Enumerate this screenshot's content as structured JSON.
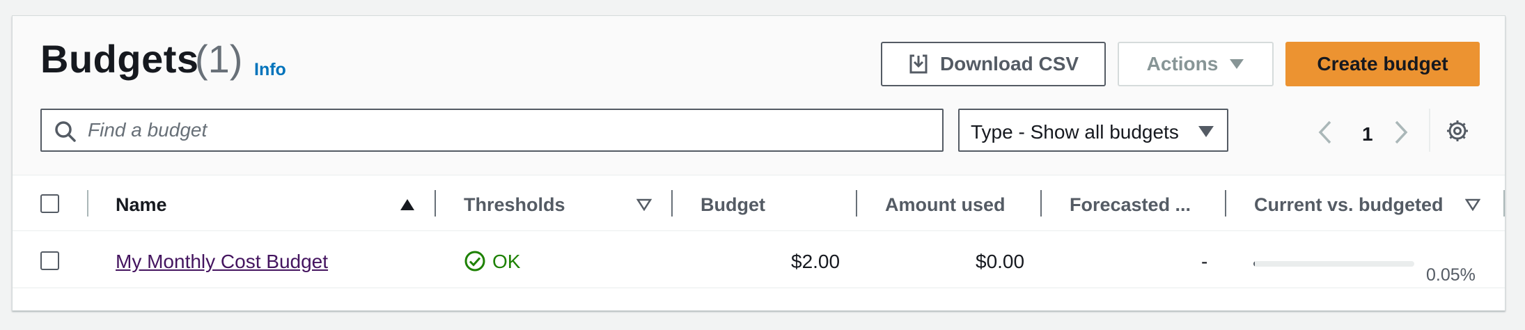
{
  "header": {
    "title": "Budgets",
    "count": "(1)",
    "info_label": "Info",
    "download_label": "Download CSV",
    "actions_label": "Actions",
    "create_label": "Create budget"
  },
  "filters": {
    "search_placeholder": "Find a budget",
    "search_value": "",
    "type_label": "Type - Show all budgets"
  },
  "pagination": {
    "current_page": "1"
  },
  "table": {
    "columns": [
      {
        "label": "Name",
        "sort": "ascending"
      },
      {
        "label": "Thresholds",
        "sort": "none"
      },
      {
        "label": "Budget"
      },
      {
        "label": "Amount used"
      },
      {
        "label": "Forecasted ..."
      },
      {
        "label": "Current vs. budgeted",
        "sort": "none"
      }
    ],
    "rows": [
      {
        "name": "My Monthly Cost Budget",
        "threshold_status": "OK",
        "budget": "$2.00",
        "amount_used": "$0.00",
        "forecasted": "-",
        "current_vs_budgeted": "0.05%",
        "current_vs_budgeted_fraction": 0.0005
      }
    ]
  },
  "colors": {
    "primary_button": "#ec9331",
    "link": "#0073bb",
    "visited_link": "#44145f",
    "ok_status": "#1d8102"
  },
  "icons": [
    "download-icon",
    "caret-down-icon",
    "search-icon",
    "chevron-left-icon",
    "chevron-right-icon",
    "settings-gear-icon",
    "sort-ascending-icon",
    "sort-icon",
    "status-ok-icon"
  ]
}
